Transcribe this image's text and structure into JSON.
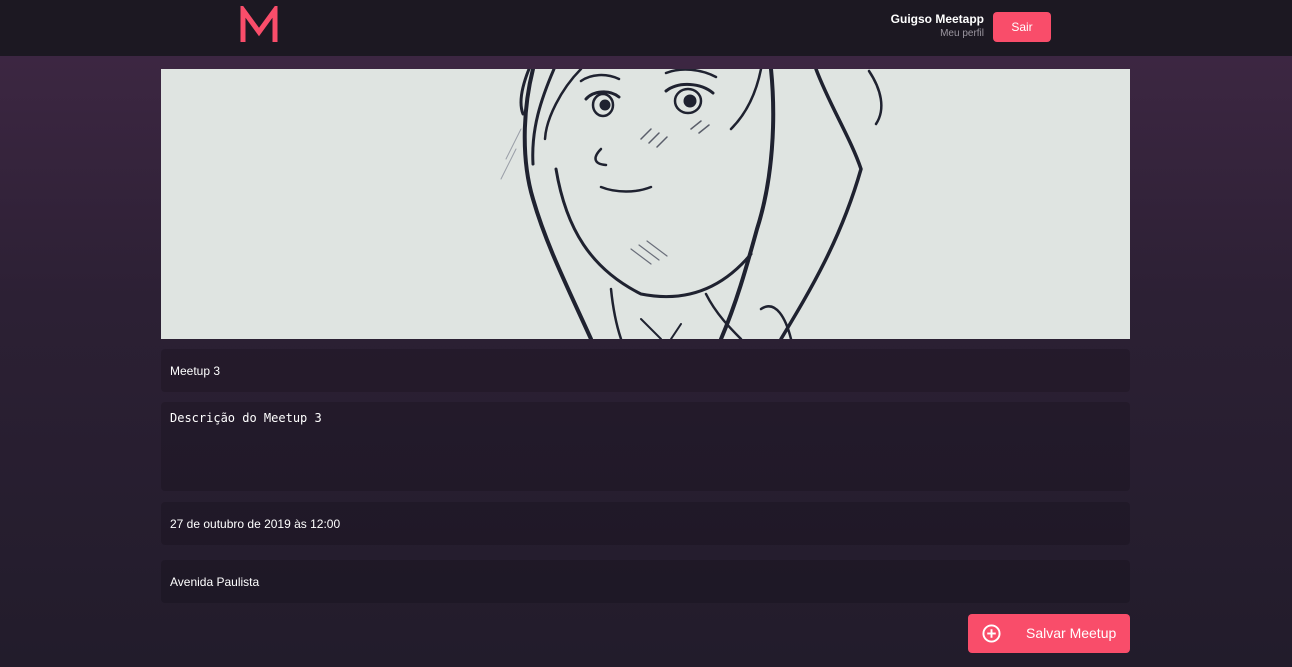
{
  "header": {
    "logo": "M",
    "user_name": "Guigso Meetapp",
    "profile_link": "Meu perfil",
    "logout_label": "Sair"
  },
  "form": {
    "banner_image": "anime-sketch-portrait",
    "title": "Meetup 3",
    "description": "Descrição do Meetup 3",
    "date": "27 de outubro de 2019 às 12:00",
    "location": "Avenida Paulista",
    "save_label": "Salvar Meetup",
    "save_icon": "plus-circle-icon"
  },
  "colors": {
    "accent": "#f94d6a",
    "header_bg": "#1c1822",
    "banner_bg": "#dfe4e1"
  }
}
